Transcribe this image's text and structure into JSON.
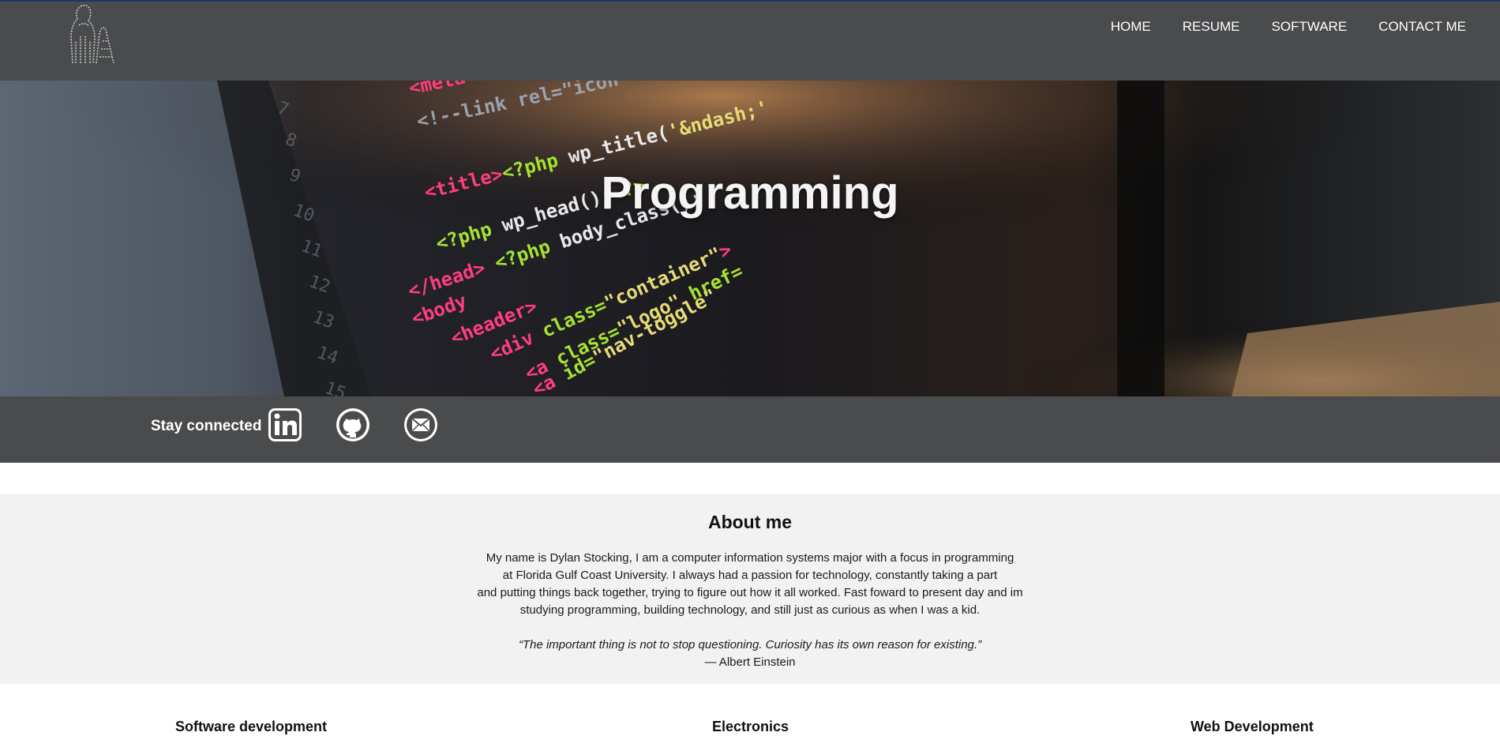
{
  "nav": {
    "links": [
      {
        "label": "HOME"
      },
      {
        "label": "RESUME"
      },
      {
        "label": "SOFTWARE"
      },
      {
        "label": "CONTACT ME"
      }
    ]
  },
  "hero": {
    "title": "Programming",
    "code_lines": [
      "<meta name=\"author\" content=\"<?php echo get_template",
      "<!--link rel=\"icon\" href=\"<?php echo",
      "<title><?php wp_title('&ndash;', true, 'right'); ?>",
      "<?php wp_head(); ?>",
      "</head>",
      "<body <?php body_class(); ?>>",
      "<header>",
      "<div class=\"container\">",
      "<a class=\"logo\" href=\"<?php echo get_home_url",
      "<a id=\"nav-toggle\" href=\"#\">"
    ]
  },
  "social": {
    "label": "Stay connected",
    "icons": [
      "linkedin-icon",
      "github-icon",
      "email-icon"
    ]
  },
  "about": {
    "title": "About me",
    "paragraph_lines": [
      "My name is Dylan Stocking, I am a computer information systems major with a focus in programming",
      "at Florida Gulf Coast University. I always had a passion for technology, constantly taking a part",
      "and putting things back together, trying to figure out how it all worked. Fast foward to present day and im",
      "studying programming, building technology, and still just as curious as when I was a kid."
    ],
    "quote": "“The important thing is not to stop questioning. Curiosity has its own reason for existing.”",
    "quote_author": "— Albert Einstein"
  },
  "sections": [
    {
      "title": "Software development"
    },
    {
      "title": "Electronics"
    },
    {
      "title": "Web Development"
    }
  ],
  "colors": {
    "nav_bg": "#4a4b4d",
    "about_bg": "#f2f2f2",
    "code_pink": "#ff3d7f",
    "code_green": "#a6e22e",
    "code_yellow": "#e6db74"
  }
}
